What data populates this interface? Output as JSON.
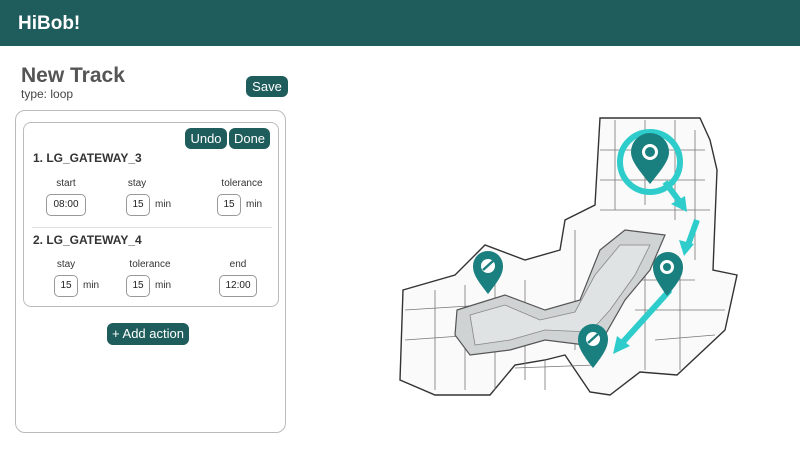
{
  "app": {
    "title": "HiBob!"
  },
  "track": {
    "title": "New Track",
    "type_text": "type: loop",
    "save_label": "Save"
  },
  "editor": {
    "undo_label": "Undo",
    "done_label": "Done",
    "steps": [
      {
        "title": "1. LG_GATEWAY_3",
        "start_label": "start",
        "start_value": "08:00",
        "stay_label": "stay",
        "stay_value": "15",
        "stay_unit": "min",
        "tolerance_label": "tolerance",
        "tolerance_value": "15",
        "tolerance_unit": "min"
      },
      {
        "title": "2. LG_GATEWAY_4",
        "stay_label": "stay",
        "stay_value": "15",
        "stay_unit": "min",
        "tolerance_label": "tolerance",
        "tolerance_value": "15",
        "tolerance_unit": "min",
        "end_label": "end",
        "end_value": "12:00"
      }
    ],
    "add_action_label": "+ Add action"
  },
  "map": {
    "accent_color": "#1aa3a3",
    "pin_color": "#1a7f7f",
    "arrow_color": "#2fcccc",
    "icons": [
      "location-pin-icon",
      "arrow-icon"
    ]
  }
}
